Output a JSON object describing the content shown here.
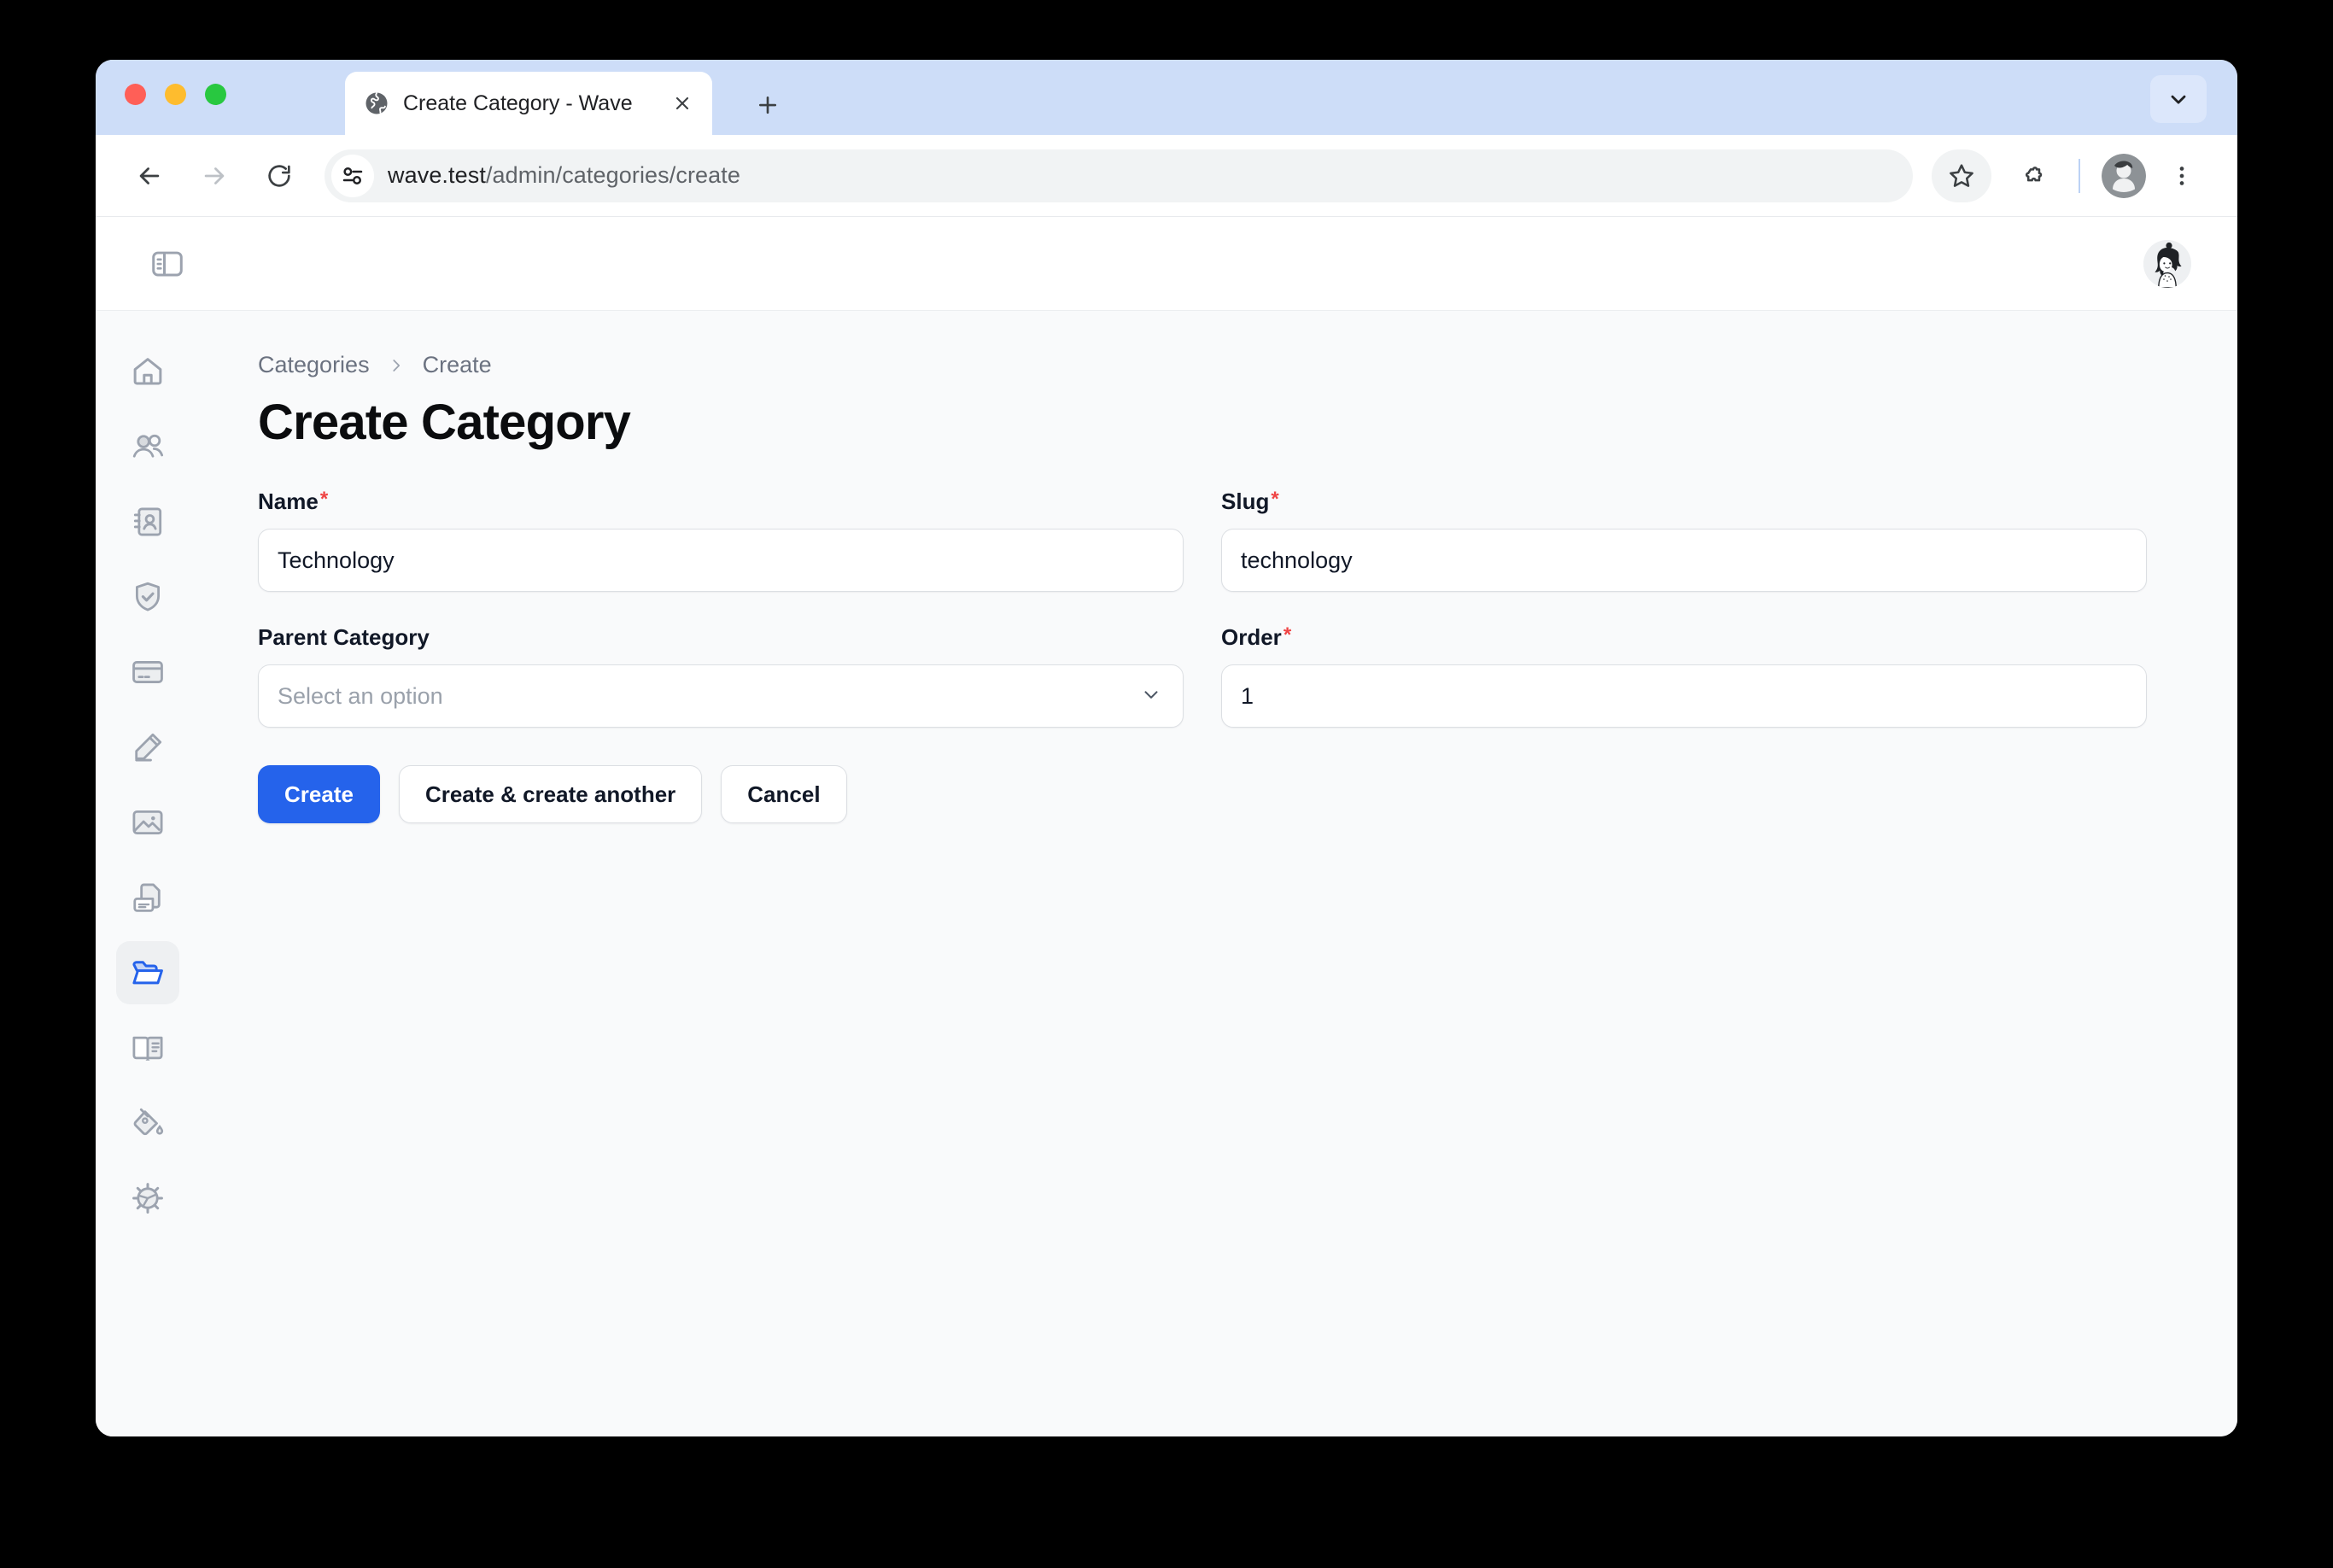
{
  "browser": {
    "traffic_lights": [
      "close",
      "minimize",
      "maximize"
    ],
    "tab": {
      "title": "Create Category - Wave",
      "favicon": "globe-icon",
      "close_icon": "close-icon"
    },
    "new_tab_icon": "plus-icon",
    "tab_list_icon": "chevron-down-icon",
    "toolbar": {
      "back_icon": "arrow-left-icon",
      "forward_icon": "arrow-right-icon",
      "reload_icon": "reload-icon",
      "site_info_icon": "tune-sliders-icon",
      "url_host": "wave.test",
      "url_path": "/admin/categories/create",
      "bookmark_icon": "star-icon",
      "extensions_icon": "puzzle-piece-icon",
      "profile_icon": "profile-avatar",
      "menu_icon": "more-vertical-icon"
    }
  },
  "app": {
    "header": {
      "panel_toggle_icon": "sidebar-toggle-icon",
      "avatar_icon": "user-avatar"
    },
    "sidebar": {
      "items": [
        {
          "name": "dashboard",
          "icon": "home-icon",
          "active": false
        },
        {
          "name": "users",
          "icon": "users-icon",
          "active": false
        },
        {
          "name": "contacts",
          "icon": "contact-book-icon",
          "active": false
        },
        {
          "name": "roles",
          "icon": "shield-check-icon",
          "active": false
        },
        {
          "name": "billing",
          "icon": "credit-card-icon",
          "active": false
        },
        {
          "name": "posts",
          "icon": "pencil-icon",
          "active": false
        },
        {
          "name": "media",
          "icon": "image-icon",
          "active": false
        },
        {
          "name": "pages",
          "icon": "documents-icon",
          "active": false
        },
        {
          "name": "categories",
          "icon": "folder-open-icon",
          "active": true
        },
        {
          "name": "docs",
          "icon": "book-open-icon",
          "active": false
        },
        {
          "name": "themes",
          "icon": "paint-bucket-icon",
          "active": false
        },
        {
          "name": "settings",
          "icon": "gear-icon",
          "active": false
        }
      ]
    },
    "breadcrumb": {
      "parent": "Categories",
      "separator_icon": "chevron-right-icon",
      "current": "Create"
    },
    "page_title": "Create Category",
    "form": {
      "name": {
        "label": "Name",
        "required": true,
        "required_marker": "*",
        "value": "Technology",
        "placeholder": ""
      },
      "slug": {
        "label": "Slug",
        "required": true,
        "required_marker": "*",
        "value": "technology",
        "placeholder": ""
      },
      "parent_category": {
        "label": "Parent Category",
        "required": false,
        "required_marker": "",
        "placeholder": "Select an option",
        "value": "",
        "chevron_icon": "chevron-down-icon"
      },
      "order": {
        "label": "Order",
        "required": true,
        "required_marker": "*",
        "value": "1",
        "placeholder": ""
      }
    },
    "actions": {
      "create_label": "Create",
      "create_another_label": "Create & create another",
      "cancel_label": "Cancel"
    }
  },
  "colors": {
    "primary": "#2563eb",
    "required": "#ef4444",
    "page_bg": "#f9fafb",
    "border": "#dcdfe3",
    "sidebar_icon": "#9ca3af",
    "tabstrip": "#cdddf8"
  }
}
